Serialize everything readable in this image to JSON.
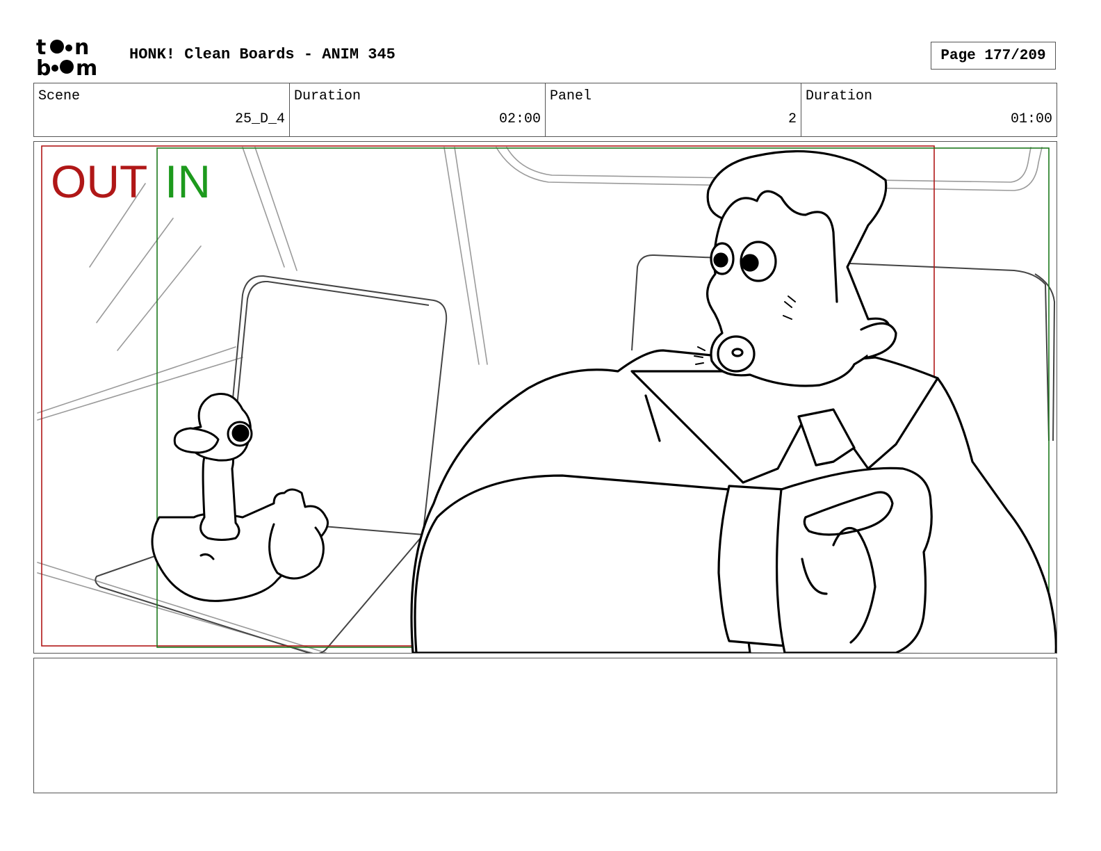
{
  "header": {
    "brand": "toon boom",
    "title": "HONK! Clean Boards - ANIM 345",
    "page_label": "Page 177/209"
  },
  "info": [
    {
      "label": "Scene",
      "value": "25_D_4"
    },
    {
      "label": "Duration",
      "value": "02:00"
    },
    {
      "label": "Panel",
      "value": "2"
    },
    {
      "label": "Duration",
      "value": "01:00"
    }
  ],
  "panel": {
    "out_label": "OUT",
    "in_label": "IN",
    "out_color": "#b01717",
    "in_color": "#1d9a1d"
  },
  "notes": {
    "text": ""
  }
}
